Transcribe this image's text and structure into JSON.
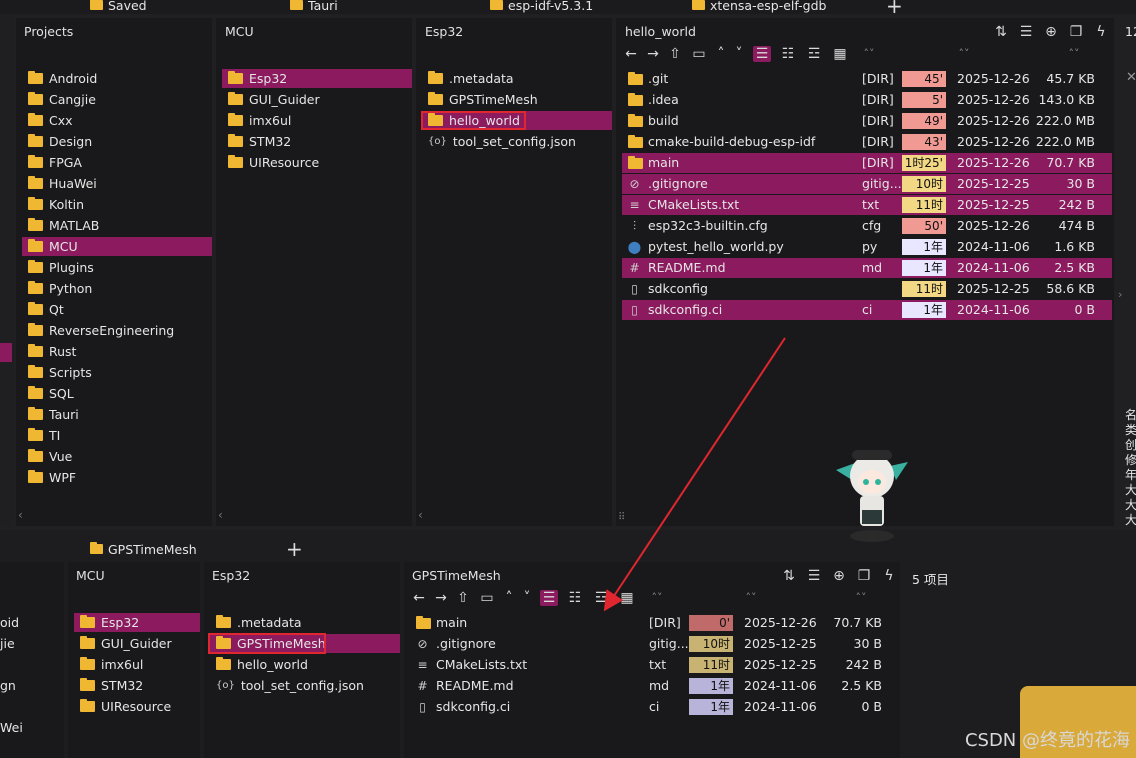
{
  "top_tabs": [
    {
      "label": "Saved"
    },
    {
      "label": "Tauri"
    },
    {
      "label": "esp-idf-v5.3.1"
    },
    {
      "label": "xtensa-esp-elf-gdb"
    }
  ],
  "top": {
    "col1": {
      "title": "Projects",
      "items": [
        "Android",
        "Cangjie",
        "Cxx",
        "Design",
        "FPGA",
        "HuaWei",
        "Koltin",
        "MATLAB",
        "MCU",
        "Plugins",
        "Python",
        "Qt",
        "ReverseEngineering",
        "Rust",
        "Scripts",
        "SQL",
        "Tauri",
        "TI",
        "Vue",
        "WPF"
      ]
    },
    "col2": {
      "title": "MCU",
      "items": [
        "Esp32",
        "GUI_Guider",
        "imx6ul",
        "STM32",
        "UIResource"
      ]
    },
    "col3": {
      "title": "Esp32",
      "items": [
        ".metadata",
        "GPSTimeMesh",
        "hello_world",
        "tool_set_config.json"
      ]
    },
    "col4": {
      "title": "hello_world"
    },
    "files": [
      {
        "name": ".git",
        "type": "[DIR]",
        "age": "45'",
        "date": "2025-12-26",
        "size": "45.7 KB"
      },
      {
        "name": ".idea",
        "type": "[DIR]",
        "age": "5'",
        "date": "2025-12-26",
        "size": "143.0 KB"
      },
      {
        "name": "build",
        "type": "[DIR]",
        "age": "49'",
        "date": "2025-12-26",
        "size": "222.0 MB"
      },
      {
        "name": "cmake-build-debug-esp-idf",
        "type": "[DIR]",
        "age": "43'",
        "date": "2025-12-26",
        "size": "222.0 MB"
      },
      {
        "name": "main",
        "type": "[DIR]",
        "age": "1时25'",
        "date": "2025-12-26",
        "size": "70.7 KB"
      },
      {
        "name": ".gitignore",
        "type": "gitig...",
        "age": "10时",
        "date": "2025-12-25",
        "size": "30 B"
      },
      {
        "name": "CMakeLists.txt",
        "type": "txt",
        "age": "11时",
        "date": "2025-12-25",
        "size": "242 B"
      },
      {
        "name": "esp32c3-builtin.cfg",
        "type": "cfg",
        "age": "50'",
        "date": "2025-12-26",
        "size": "474 B"
      },
      {
        "name": "pytest_hello_world.py",
        "type": "py",
        "age": "1年",
        "date": "2024-11-06",
        "size": "1.6 KB"
      },
      {
        "name": "README.md",
        "type": "md",
        "age": "1年",
        "date": "2024-11-06",
        "size": "2.5 KB"
      },
      {
        "name": "sdkconfig",
        "type": "",
        "age": "11时",
        "date": "2025-12-25",
        "size": "58.6 KB"
      },
      {
        "name": "sdkconfig.ci",
        "type": "ci",
        "age": "1年",
        "date": "2024-11-06",
        "size": "0 B"
      }
    ],
    "right_edge_text": "12",
    "right_vertical": [
      "名",
      "类",
      "创",
      "修",
      "年",
      "大",
      "大",
      "大"
    ]
  },
  "bottom": {
    "tab": "GPSTimeMesh",
    "col0_items": [
      "oid",
      "jie",
      "",
      "gn",
      "",
      "Wei",
      ""
    ],
    "col1": {
      "title": "MCU",
      "items": [
        "Esp32",
        "GUI_Guider",
        "imx6ul",
        "STM32",
        "UIResource"
      ]
    },
    "col2": {
      "title": "Esp32",
      "items": [
        ".metadata",
        "GPSTimeMesh",
        "hello_world",
        "tool_set_config.json"
      ]
    },
    "col3": {
      "title": "GPSTimeMesh"
    },
    "item_count": "5 项目",
    "files": [
      {
        "name": "main",
        "type": "[DIR]",
        "age": "0'",
        "date": "2025-12-26",
        "size": "70.7 KB"
      },
      {
        "name": ".gitignore",
        "type": "gitig...",
        "age": "10时",
        "date": "2025-12-25",
        "size": "30 B"
      },
      {
        "name": "CMakeLists.txt",
        "type": "txt",
        "age": "11时",
        "date": "2025-12-25",
        "size": "242 B"
      },
      {
        "name": "README.md",
        "type": "md",
        "age": "1年",
        "date": "2024-11-06",
        "size": "2.5 KB"
      },
      {
        "name": "sdkconfig.ci",
        "type": "ci",
        "age": "1年",
        "date": "2024-11-06",
        "size": "0 B"
      }
    ]
  },
  "watermark": "CSDN @终竟的花海"
}
